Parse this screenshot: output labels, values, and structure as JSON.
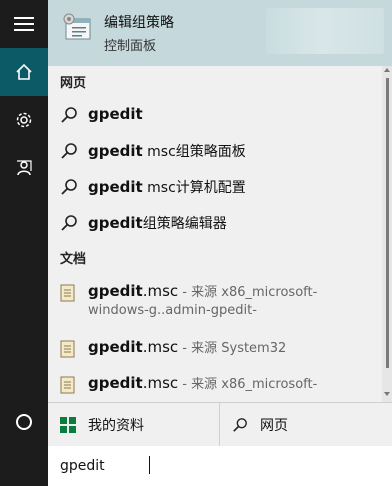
{
  "best_match": {
    "title": "编辑组策略",
    "subtitle": "控制面板",
    "icon": "group-policy-icon"
  },
  "sections": {
    "web": "网页",
    "documents": "文档"
  },
  "web_results": [
    {
      "bold": "gpedit",
      "rest": ""
    },
    {
      "bold": "gpedit",
      "rest": " msc组策略面板"
    },
    {
      "bold": "gpedit",
      "rest": " msc计算机配置"
    },
    {
      "bold": "gpedit",
      "rest": "组策略编辑器"
    }
  ],
  "doc_results": [
    {
      "bold": "gpedit",
      "ext": ".msc",
      "source": " - 来源 x86_microsoft-",
      "line2": "windows-g..admin-gpedit-"
    },
    {
      "bold": "gpedit",
      "ext": ".msc",
      "source": " - 来源 System32",
      "line2": ""
    },
    {
      "bold": "gpedit",
      "ext": ".msc",
      "source": " - 来源 x86_microsoft-",
      "line2": ""
    }
  ],
  "filters": {
    "my_stuff": "我的资料",
    "web": "网页"
  },
  "search": {
    "value": "gpedit"
  },
  "colors": {
    "rail": "#1c1c1c",
    "rail_active": "#0b5a65",
    "best_match_bg": "#c5d9dd",
    "panel_bg": "#f0f0f0"
  }
}
